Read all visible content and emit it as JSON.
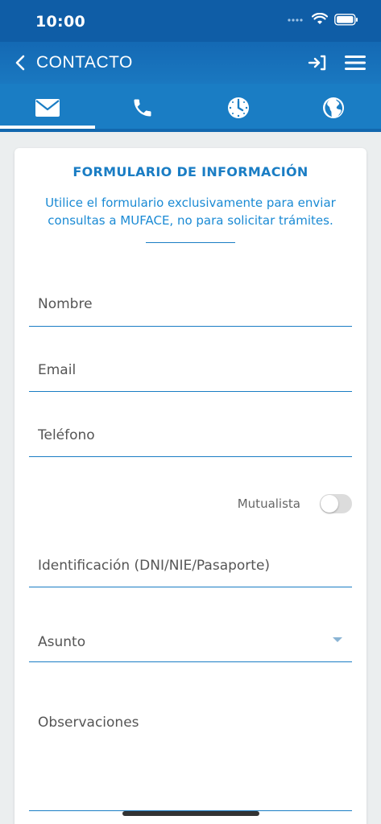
{
  "status_bar": {
    "time": "10:00"
  },
  "header": {
    "title": "CONTACTO"
  },
  "tabs": [
    {
      "name": "email",
      "icon": "mail-icon",
      "active": true
    },
    {
      "name": "phone",
      "icon": "phone-icon",
      "active": false
    },
    {
      "name": "hours",
      "icon": "clock-icon",
      "active": false
    },
    {
      "name": "web",
      "icon": "globe-icon",
      "active": false
    }
  ],
  "form": {
    "title": "FORMULARIO DE INFORMACIÓN",
    "description": "Utilice el formulario exclusivamente para enviar consultas a MUFACE, no para solicitar trámites.",
    "fields": {
      "nombre": {
        "placeholder": "Nombre",
        "value": ""
      },
      "email": {
        "placeholder": "Email",
        "value": ""
      },
      "telefono": {
        "placeholder": "Teléfono",
        "value": ""
      },
      "identificacion": {
        "placeholder": "Identificación (DNI/NIE/Pasaporte)",
        "value": ""
      },
      "asunto": {
        "label": "Asunto"
      },
      "observaciones": {
        "placeholder": "Observaciones",
        "value": ""
      }
    },
    "mutualista": {
      "label": "Mutualista",
      "checked": false
    }
  },
  "colors": {
    "primary": "#1a7dc4",
    "header": "#1469b4",
    "statusbar": "#0f5da6",
    "background": "#ebeeef"
  }
}
